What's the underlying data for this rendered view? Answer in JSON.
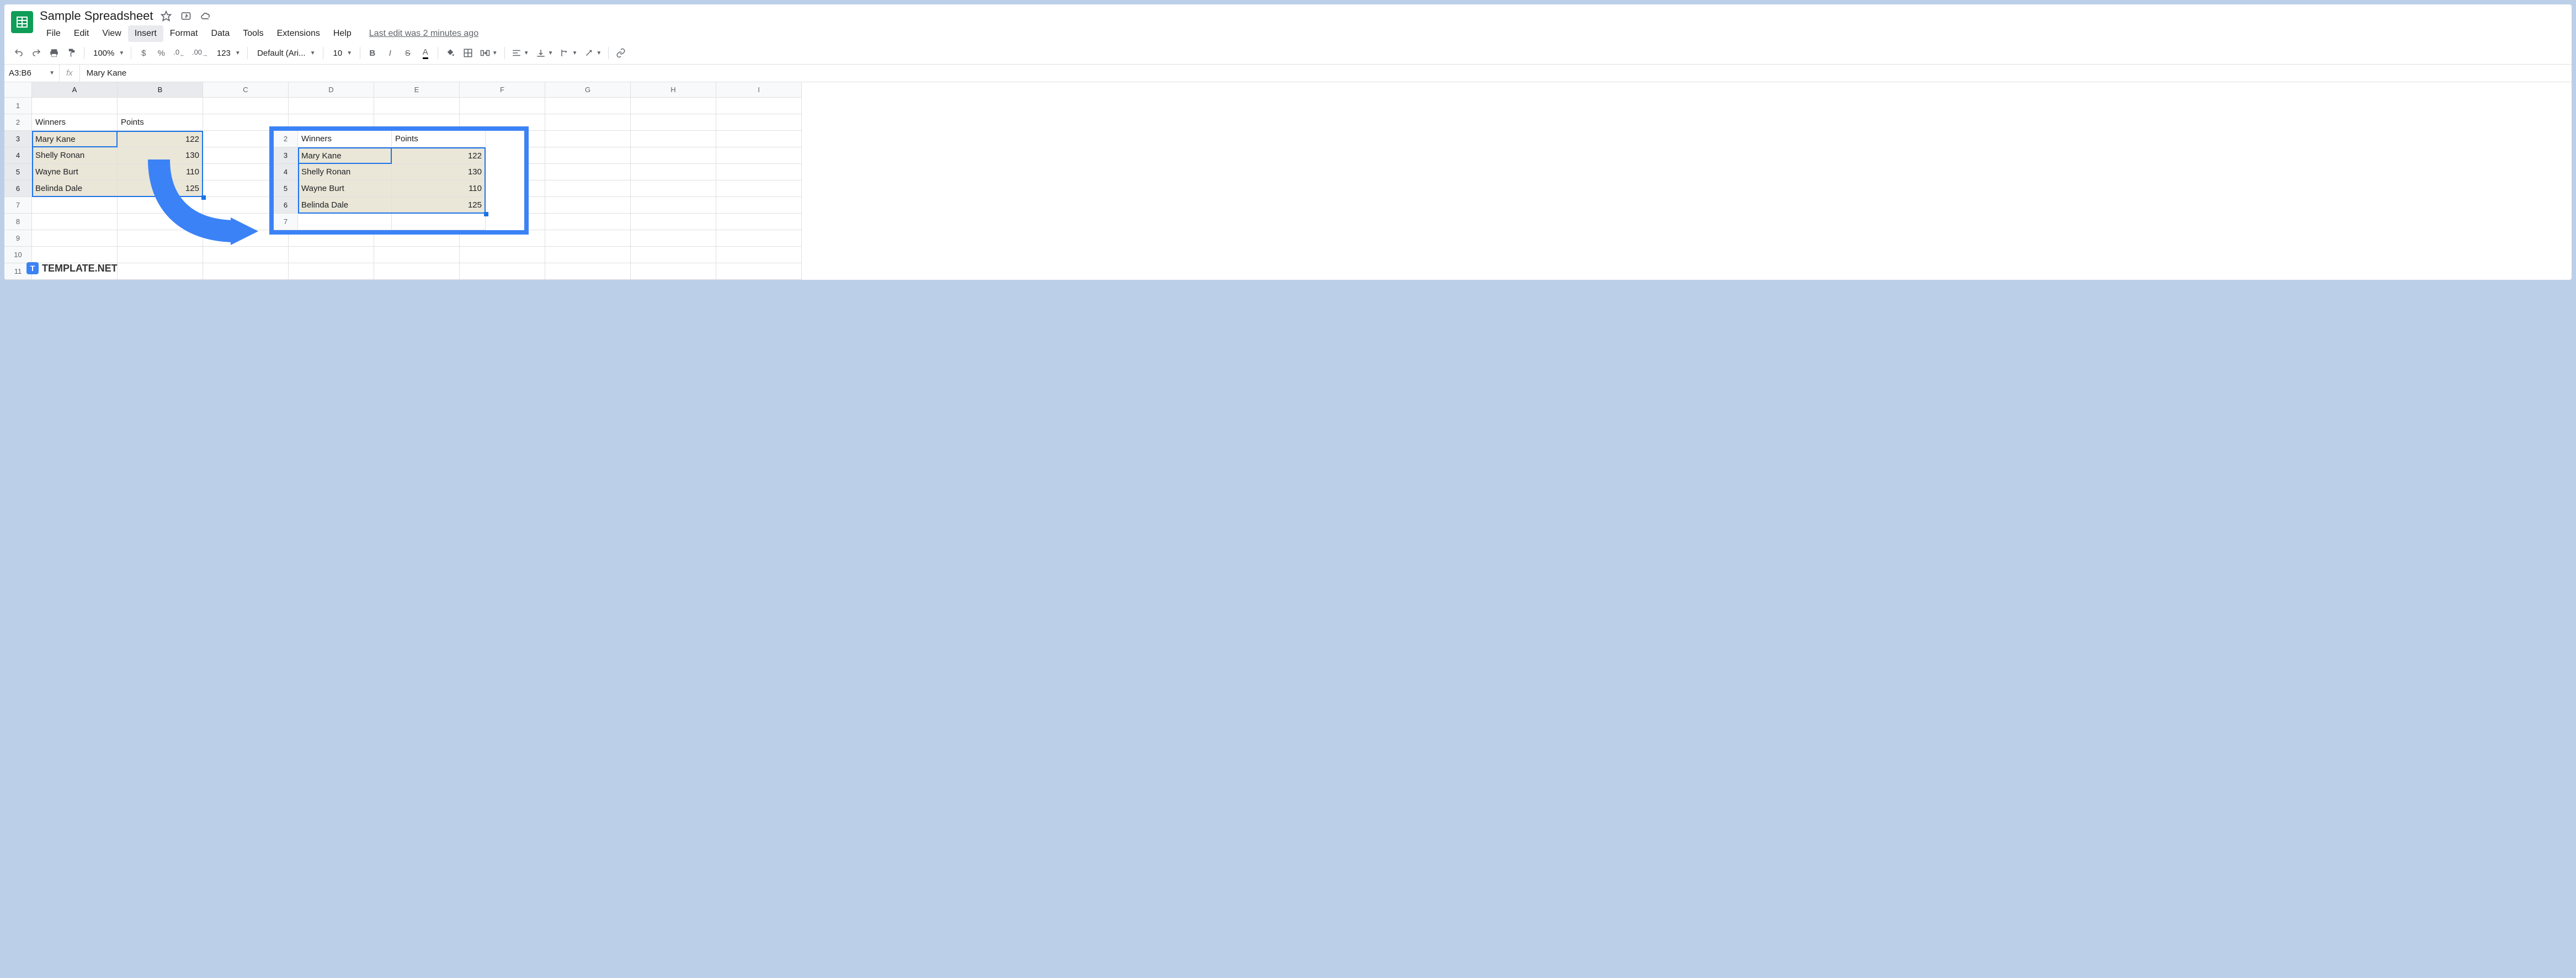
{
  "doc_title": "Sample Spreadsheet",
  "menu": [
    "File",
    "Edit",
    "View",
    "Insert",
    "Format",
    "Data",
    "Tools",
    "Extensions",
    "Help"
  ],
  "menu_active": "Insert",
  "last_edit": "Last edit was 2 minutes ago",
  "toolbar": {
    "zoom": "100%",
    "currency": "$",
    "percent": "%",
    "dec_dec": ".0",
    "inc_dec": ".00",
    "more_fmt": "123",
    "font": "Default (Ari...",
    "size": "10",
    "bold": "B",
    "italic": "I",
    "strike": "S",
    "text_color": "A"
  },
  "name_box": "A3:B6",
  "fx": "fx",
  "formula": "Mary Kane",
  "columns": [
    "A",
    "B",
    "C",
    "D",
    "E",
    "F",
    "G",
    "H",
    "I"
  ],
  "rows": [
    "1",
    "2",
    "3",
    "4",
    "5",
    "6",
    "7",
    "8",
    "9",
    "10",
    "11"
  ],
  "cells": {
    "A2": "Winners",
    "B2": "Points",
    "A3": "Mary Kane",
    "B3": "122",
    "A4": "Shelly Ronan",
    "B4": "130",
    "A5": "Wayne Burt",
    "B5": "110",
    "A6": "Belinda Dale",
    "B6": "125"
  },
  "overlay": {
    "rows": [
      "2",
      "3",
      "4",
      "5",
      "6",
      "7"
    ],
    "cells": {
      "A2": "Winners",
      "B2": "Points",
      "A3": "Mary Kane",
      "B3": "122",
      "A4": "Shelly Ronan",
      "B4": "130",
      "A5": "Wayne Burt",
      "B5": "110",
      "A6": "Belinda Dale",
      "B6": "125"
    }
  },
  "watermark": "TEMPLATE.NET",
  "watermark_icon": "T"
}
